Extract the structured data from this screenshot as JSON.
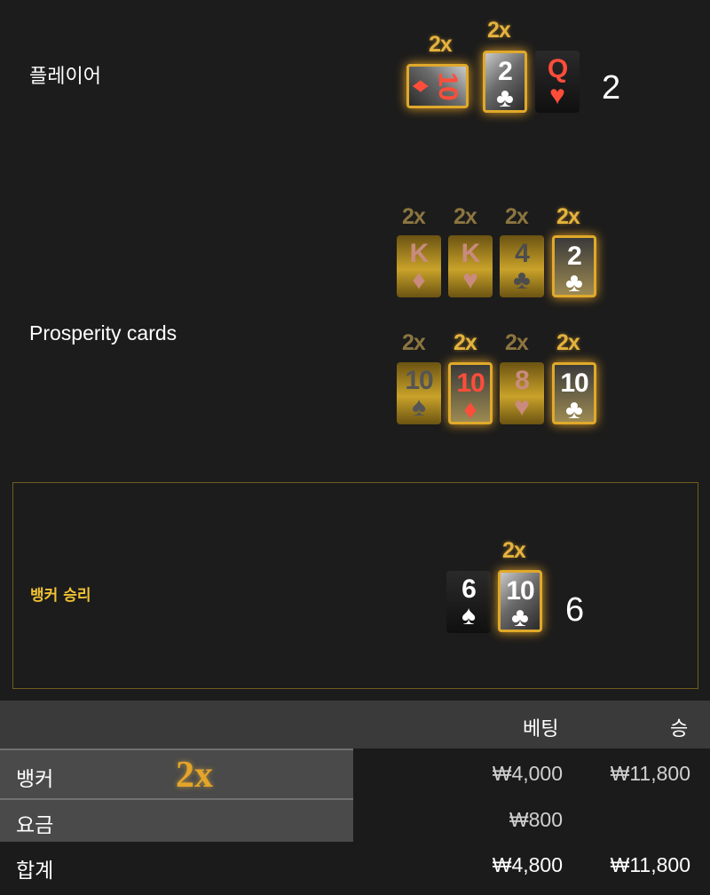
{
  "player": {
    "label": "플레이어",
    "score": "2",
    "cards": [
      {
        "rank": "10",
        "suit": "♦",
        "multiplier": "2x"
      },
      {
        "rank": "2",
        "suit": "♣",
        "multiplier": "2x"
      },
      {
        "rank": "Q",
        "suit": "♥",
        "multiplier": ""
      }
    ]
  },
  "prosperity": {
    "label": "Prosperity cards",
    "row1": [
      {
        "rank": "K",
        "suit": "♦",
        "multiplier": "2x"
      },
      {
        "rank": "K",
        "suit": "♥",
        "multiplier": "2x"
      },
      {
        "rank": "4",
        "suit": "♣",
        "multiplier": "2x"
      },
      {
        "rank": "2",
        "suit": "♣",
        "multiplier": "2x"
      }
    ],
    "row2": [
      {
        "rank": "10",
        "suit": "♠",
        "multiplier": "2x"
      },
      {
        "rank": "10",
        "suit": "♦",
        "multiplier": "2x"
      },
      {
        "rank": "8",
        "suit": "♥",
        "multiplier": "2x"
      },
      {
        "rank": "10",
        "suit": "♣",
        "multiplier": "2x"
      }
    ]
  },
  "banker": {
    "label": "뱅커 승리",
    "score": "6",
    "cards": [
      {
        "rank": "6",
        "suit": "♠",
        "multiplier": ""
      },
      {
        "rank": "10",
        "suit": "♣",
        "multiplier": "2x"
      }
    ]
  },
  "table": {
    "headers": {
      "bet": "베팅",
      "win": "승"
    },
    "rows": [
      {
        "name": "뱅커",
        "multiplier": "2x",
        "bet": "₩4,000",
        "win": "₩11,800"
      },
      {
        "name": "요금",
        "bet": "₩800",
        "win": ""
      }
    ],
    "total": {
      "name": "합계",
      "bet": "₩4,800",
      "win": "₩11,800"
    }
  }
}
